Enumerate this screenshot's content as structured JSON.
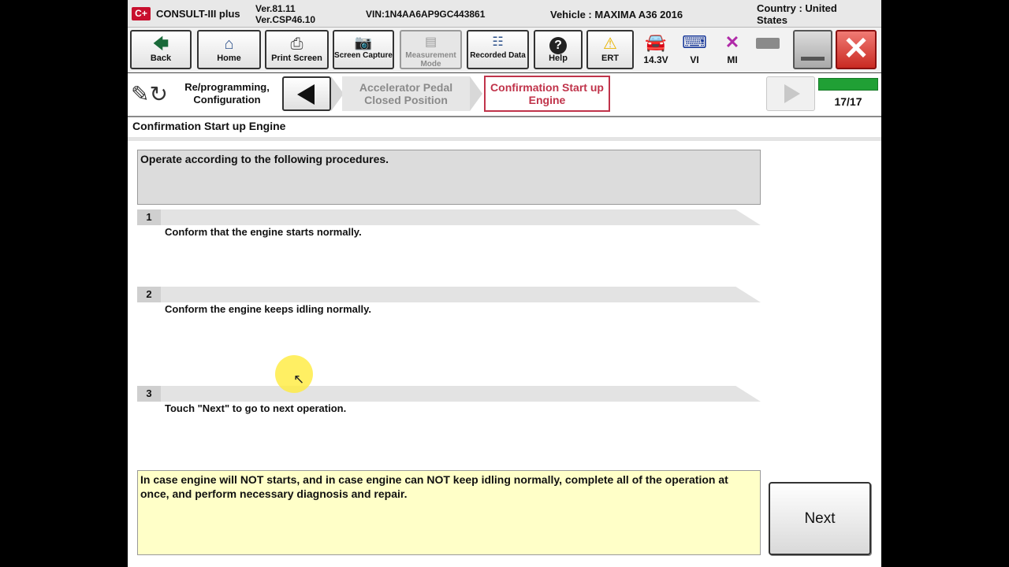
{
  "titlebar": {
    "logo": "C+",
    "app_name": "CONSULT-III plus",
    "version_1": "Ver.81.11",
    "version_2": "Ver.CSP46.10",
    "vin": "VIN:1N4AA6AP9GC443861",
    "vehicle": "Vehicle : MAXIMA A36 2016",
    "country": "Country : United States"
  },
  "toolbar": {
    "buttons": [
      {
        "label": "Back",
        "icon": "back-arrow-icon"
      },
      {
        "label": "Home",
        "icon": "home-icon"
      },
      {
        "label": "Print Screen",
        "icon": "printer-icon"
      },
      {
        "label": "Screen Capture",
        "icon": "camera-icon"
      },
      {
        "label": "Measurement Mode",
        "icon": "measurement-icon",
        "disabled": true
      },
      {
        "label": "Recorded Data",
        "icon": "recorded-data-icon"
      },
      {
        "label": "Help",
        "icon": "help-icon"
      },
      {
        "label": "ERT",
        "icon": "warning-icon"
      }
    ],
    "battery_voltage": "14.3V",
    "vi_label": "VI",
    "mi_label": "MI"
  },
  "breadcrumb": {
    "section_label": "Re/programming, Configuration",
    "prev_step": "Accelerator Pedal Closed Position",
    "current_step": "Confirmation Start up Engine",
    "step_count": "17/17",
    "progress": 1.0
  },
  "content": {
    "title": "Confirmation Start up Engine",
    "instruction": "Operate according to the following procedures.",
    "steps": [
      {
        "num": "1",
        "text": "Conform that the engine starts normally."
      },
      {
        "num": "2",
        "text": "Conform the engine keeps idling normally."
      },
      {
        "num": "3",
        "text": "Touch \"Next\" to go to next operation."
      }
    ],
    "warning": "In case engine will NOT starts, and in case engine can NOT keep idling normally, complete all of the operation at once, and perform necessary diagnosis and repair.",
    "next_label": "Next"
  },
  "colors": {
    "current_step": "#c0334a",
    "progress": "#20a035",
    "warning_bg": "#ffffc8",
    "close": "#c92a22"
  }
}
